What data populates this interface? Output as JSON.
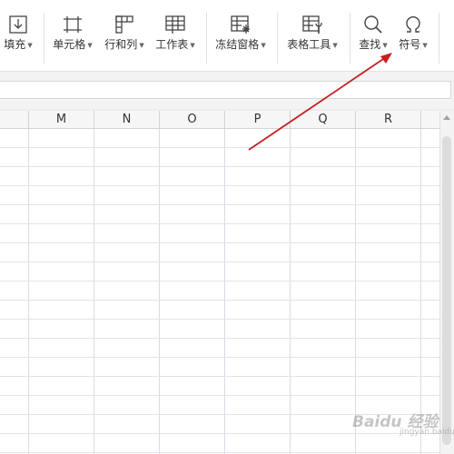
{
  "ribbon": {
    "tools": [
      {
        "label": "填充",
        "icon": "fill-down-icon"
      },
      {
        "label": "单元格",
        "icon": "cell-icon"
      },
      {
        "label": "行和列",
        "icon": "rows-columns-icon"
      },
      {
        "label": "工作表",
        "icon": "worksheet-icon"
      },
      {
        "label": "冻结窗格",
        "icon": "freeze-panes-icon"
      },
      {
        "label": "表格工具",
        "icon": "table-tools-icon"
      },
      {
        "label": "查找",
        "icon": "search-icon"
      },
      {
        "label": "符号",
        "icon": "omega-icon"
      }
    ]
  },
  "columns": [
    "M",
    "N",
    "O",
    "P",
    "Q",
    "R"
  ],
  "annotation": {
    "type": "arrow",
    "color": "#c81e1e",
    "points_to": "查找"
  },
  "watermark": {
    "text": "Baidu 经验",
    "sub": "jingyan.baidu.com"
  }
}
